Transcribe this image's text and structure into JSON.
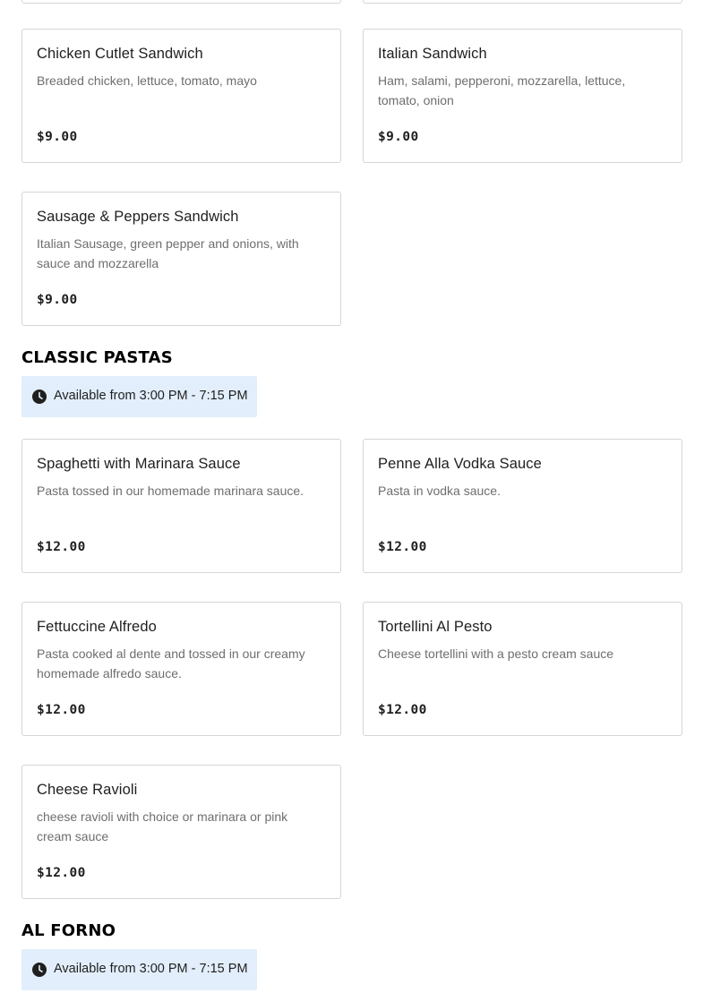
{
  "sections": {
    "sandwiches": {
      "items": [
        {
          "name": "Chicken Cutlet Sandwich",
          "description": "Breaded chicken, lettuce, tomato, mayo",
          "price": "$9.00"
        },
        {
          "name": "Italian Sandwich",
          "description": "Ham, salami, pepperoni, mozzarella, lettuce, tomato, onion",
          "price": "$9.00"
        },
        {
          "name": "Sausage & Peppers Sandwich",
          "description": "Italian Sausage, green pepper and onions, with sauce and mozzarella",
          "price": "$9.00"
        }
      ]
    },
    "classic_pastas": {
      "title": "CLASSIC PASTAS",
      "availability": "Available from 3:00 PM - 7:15 PM",
      "availability_icon": "clock-icon",
      "items": [
        {
          "name": "Spaghetti with Marinara Sauce",
          "description": "Pasta tossed in our homemade marinara sauce.",
          "price": "$12.00"
        },
        {
          "name": "Penne Alla Vodka Sauce",
          "description": "Pasta in vodka sauce.",
          "price": "$12.00"
        },
        {
          "name": "Fettuccine Alfredo",
          "description": "Pasta cooked al dente and tossed in our creamy homemade alfredo sauce.",
          "price": "$12.00"
        },
        {
          "name": "Tortellini Al Pesto",
          "description": "Cheese tortellini with a pesto cream sauce",
          "price": "$12.00"
        },
        {
          "name": "Cheese Ravioli",
          "description": "cheese ravioli with choice or marinara or pink cream sauce",
          "price": "$12.00"
        }
      ]
    },
    "al_forno": {
      "title": "AL FORNO",
      "availability": "Available from 3:00 PM - 7:15 PM",
      "availability_icon": "clock-icon"
    }
  },
  "colors": {
    "availability_background": "#e2eefb",
    "card_border": "#d6d6d6",
    "description_text": "#6e6e6e"
  }
}
